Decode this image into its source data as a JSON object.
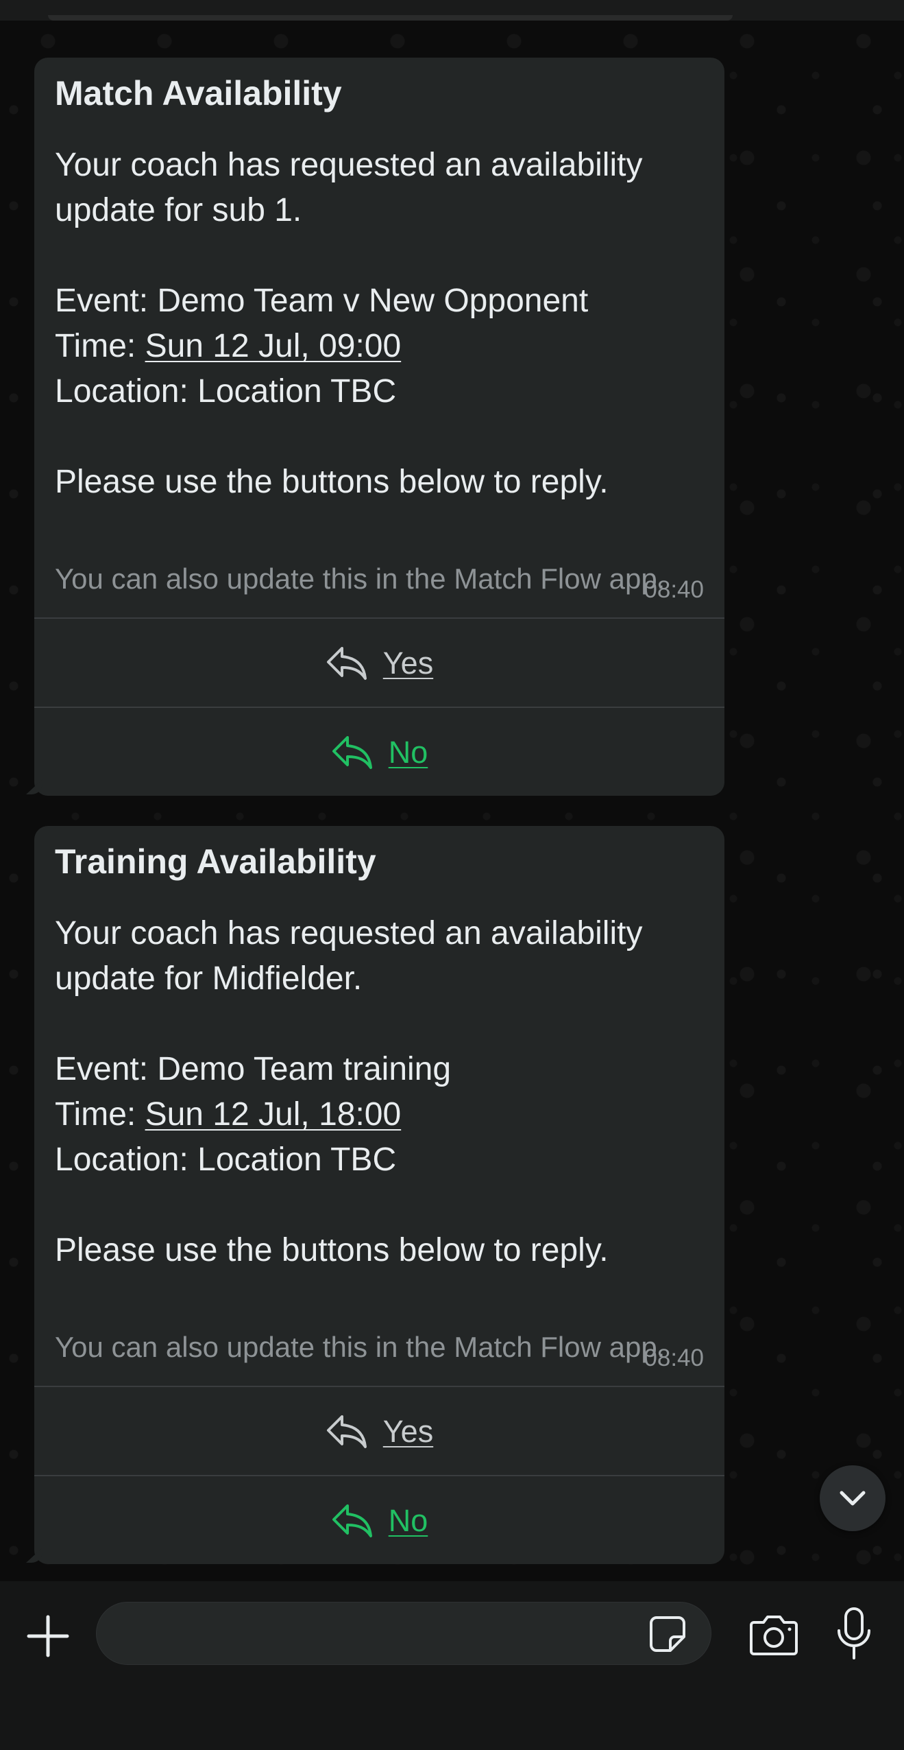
{
  "messages": [
    {
      "title": "Match Availability",
      "intro_line1": "Your coach has requested an availability",
      "intro_line2": "update for sub 1.",
      "event_label": "Event:",
      "event_value": "Demo Team v New Opponent",
      "time_label": "Time:",
      "time_value": "Sun 12 Jul, 09:00",
      "location_label": "Location:",
      "location_value": "Location TBC",
      "instruction": "Please use the buttons below to reply.",
      "footer": "You can also update this in the Match Flow app.",
      "timestamp": "08:40",
      "buttons": [
        {
          "label": "Yes",
          "icon": "reply-icon",
          "color": "#c8ccce"
        },
        {
          "label": "No",
          "icon": "reply-icon",
          "color": "#21c063"
        }
      ]
    },
    {
      "title": "Training Availability",
      "intro_line1": "Your coach has requested an availability",
      "intro_line2": "update for Midfielder.",
      "event_label": "Event:",
      "event_value": "Demo Team training",
      "time_label": "Time:",
      "time_value": "Sun 12 Jul, 18:00",
      "location_label": "Location:",
      "location_value": "Location TBC",
      "instruction": "Please use the buttons below to reply.",
      "footer": "You can also update this in the Match Flow app.",
      "timestamp": "08:40",
      "buttons": [
        {
          "label": "Yes",
          "icon": "reply-icon",
          "color": "#c8ccce"
        },
        {
          "label": "No",
          "icon": "reply-icon",
          "color": "#21c063"
        }
      ]
    }
  ],
  "input_bar": {
    "placeholder": "",
    "icons": [
      "plus-icon",
      "sticker-icon",
      "camera-icon",
      "microphone-icon"
    ]
  },
  "scroll_button_icon": "chevron-down-icon",
  "colors": {
    "bubble": "#232626",
    "accent_green": "#21c063",
    "secondary_text": "#8e9396",
    "background": "#0c0c0c"
  }
}
